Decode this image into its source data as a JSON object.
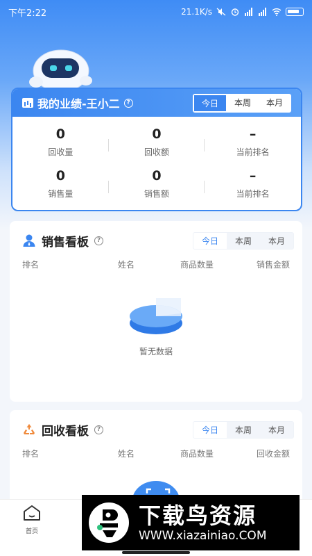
{
  "status_bar": {
    "time": "下午2:22",
    "speed": "21.1K/s"
  },
  "performance": {
    "title": "我的业绩-王小二",
    "tabs": [
      "今日",
      "本周",
      "本月"
    ],
    "active_tab": "今日",
    "stats": [
      {
        "value": "0",
        "label": "回收量"
      },
      {
        "value": "0",
        "label": "回收额"
      },
      {
        "value": "–",
        "label": "当前排名"
      },
      {
        "value": "0",
        "label": "销售量"
      },
      {
        "value": "0",
        "label": "销售额"
      },
      {
        "value": "–",
        "label": "当前排名"
      }
    ]
  },
  "sales_board": {
    "title": "销售看板",
    "tabs": [
      "今日",
      "本周",
      "本月"
    ],
    "active_tab": "今日",
    "columns": [
      "排名",
      "姓名",
      "商品数量",
      "销售金额"
    ],
    "empty_text": "暂无数据"
  },
  "recycle_board": {
    "title": "回收看板",
    "tabs": [
      "今日",
      "本周",
      "本月"
    ],
    "active_tab": "今日",
    "columns": [
      "排名",
      "姓名",
      "商品数量",
      "回收金额"
    ]
  },
  "bottom_nav": {
    "home_label": "首页"
  },
  "watermark": {
    "brand": "下载鸟资源",
    "url": "WWW.xiazainiao.COM"
  },
  "colors": {
    "primary": "#3b86f0",
    "accent_orange": "#f08a3c"
  }
}
